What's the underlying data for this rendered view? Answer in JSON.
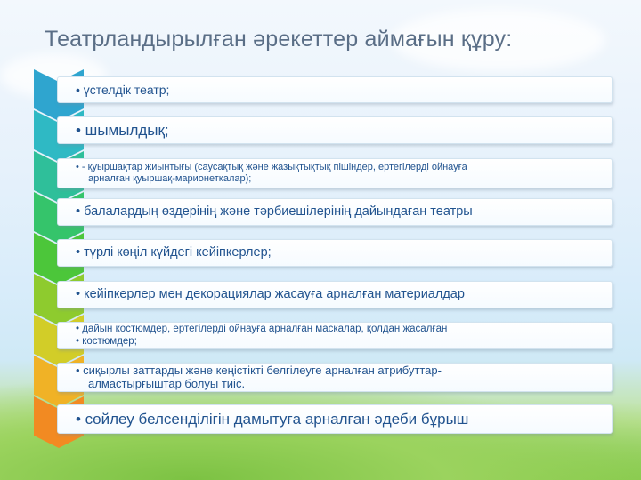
{
  "title": "Театрландырылған әрекеттер аймағын құру:",
  "items": [
    {
      "lines": [
        "• үстелдік театр;"
      ],
      "color": "#2fa5cf"
    },
    {
      "lines": [
        "• шымылдық;"
      ],
      "color": "#2fb9c4"
    },
    {
      "lines": [
        "• - қуыршақтар жиынтығы (саусақтық және жазықтықтық пішіндер, ертегілерді ойнауға",
        "арналған қуыршақ-марионеткалар);"
      ],
      "color": "#2fbf9a"
    },
    {
      "lines": [
        "•    балалардың өздерінің және тәрбиешілерінің  дайындаған  театры"
      ],
      "color": "#35c46b"
    },
    {
      "lines": [
        "• түрлі көңіл күйдегі кейіпкерлер;"
      ],
      "color": "#4cc63a"
    },
    {
      "lines": [
        "• кейіпкерлер мен декорациялар жасауға арналған материалдар"
      ],
      "color": "#8ecb2e"
    },
    {
      "lines": [
        "•   дайын костюмдер, ертегілерді ойнауға арналған маскалар, қолдан жасалған",
        "• костюмдер;"
      ],
      "color": "#d2cd28"
    },
    {
      "lines": [
        "• сиқырлы заттарды және кеңістікті белгілеуге арналған атрибуттар-",
        "алмастырғыштар болуы тиіс."
      ],
      "color": "#f0b226"
    },
    {
      "lines": [
        "• сөйлеу  белсенділігін  дамытуға арналған әдеби бұрыш"
      ],
      "color": "#f28a22"
    }
  ]
}
